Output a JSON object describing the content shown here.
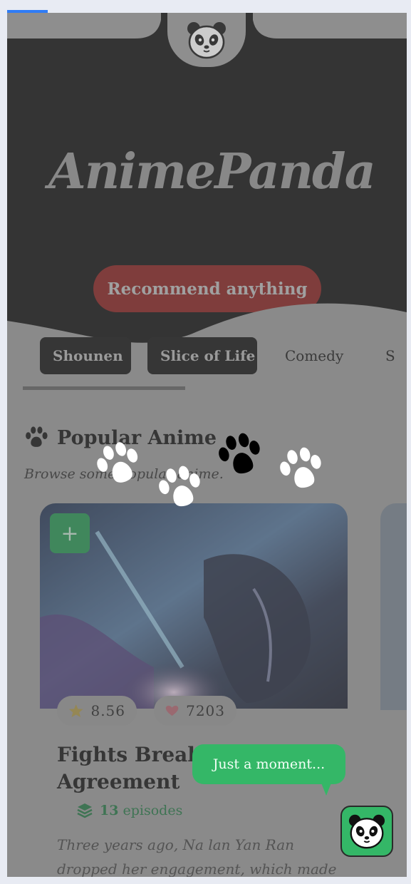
{
  "brand": {
    "name": "AnimePanda"
  },
  "hero": {
    "cta_label": "Recommend anything"
  },
  "genres": [
    "Shounen",
    "Slice of Life",
    "Comedy",
    "S"
  ],
  "popular": {
    "title": "Popular Anime",
    "subtitle": "Browse some popular anime."
  },
  "card": {
    "rating": "8.56",
    "likes": "7203",
    "title": "Fights Break Sphere: Three Year Agreement",
    "title_visible": "Fights Break S... Year Agreement",
    "episodes_count": "13",
    "episodes_label": "episodes",
    "description": "Three years ago, Na lan Yan Ran dropped her engagement, which made"
  },
  "loader": {
    "message": "Just a moment..."
  },
  "colors": {
    "accent_green": "#34b767",
    "cta_red": "#7e1a17",
    "hero_bg": "#0b0b0b",
    "loading_bar": "#2f7cf6"
  },
  "icons": [
    "panda-logo-icon",
    "paw-icon",
    "plus-icon",
    "star-icon",
    "heart-icon",
    "layers-icon"
  ]
}
